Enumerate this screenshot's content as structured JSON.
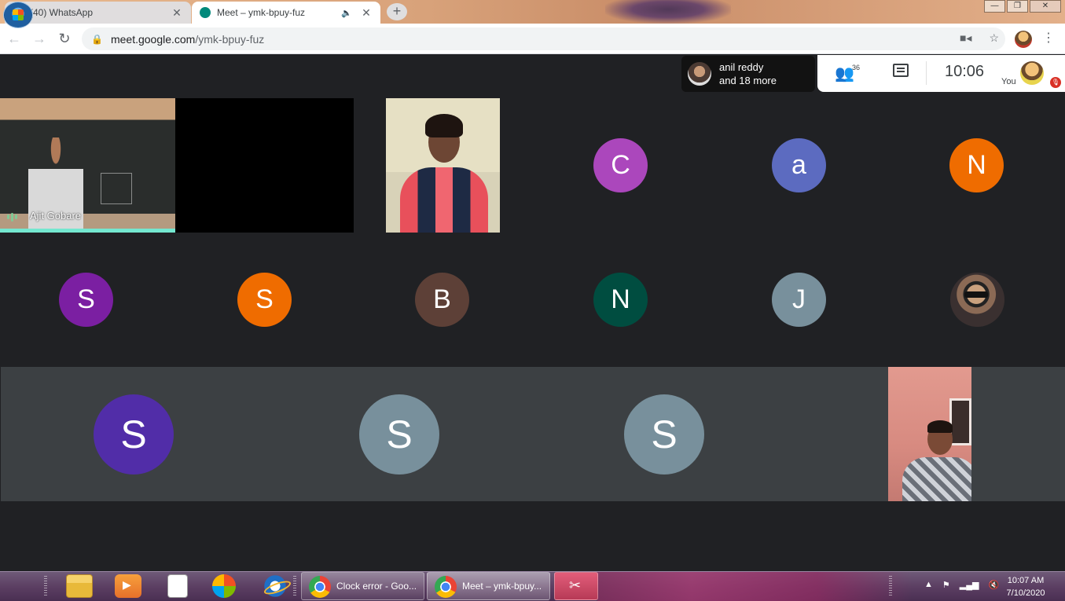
{
  "browser": {
    "tabs": [
      {
        "label": "(40) WhatsApp",
        "badge": "40",
        "active": false
      },
      {
        "label": "Meet – ymk-bpuy-fuz",
        "active": true
      }
    ],
    "url_host": "meet.google.com",
    "url_path": "/ymk-bpuy-fuz"
  },
  "meet": {
    "presenter": {
      "line1": "anil reddy",
      "line2": "and 18 more"
    },
    "participant_count": "36",
    "clock": "10:06",
    "you_label": "You",
    "tiles": {
      "teacher_name": "Ajit Gobare",
      "row1": [
        {
          "initial": "C",
          "color": "#ab47bc"
        },
        {
          "initial": "a",
          "color": "#5c6bc0"
        },
        {
          "initial": "N",
          "color": "#ef6c00"
        }
      ],
      "row2": [
        {
          "initial": "S",
          "color": "#7b1fa2"
        },
        {
          "initial": "S",
          "color": "#ef6c00"
        },
        {
          "initial": "B",
          "color": "#5d4037"
        },
        {
          "initial": "N",
          "color": "#004d40"
        },
        {
          "initial": "J",
          "color": "#78909c"
        }
      ],
      "row3": [
        {
          "initial": "S",
          "color": "#512da8"
        },
        {
          "initial": "S",
          "color": "#78909c"
        },
        {
          "initial": "S",
          "color": "#78909c"
        }
      ]
    }
  },
  "taskbar": {
    "buttons": [
      {
        "label": "Clock error - Goo..."
      },
      {
        "label": "Meet – ymk-bpuy..."
      }
    ],
    "time": "10:07 AM",
    "date": "7/10/2020"
  }
}
